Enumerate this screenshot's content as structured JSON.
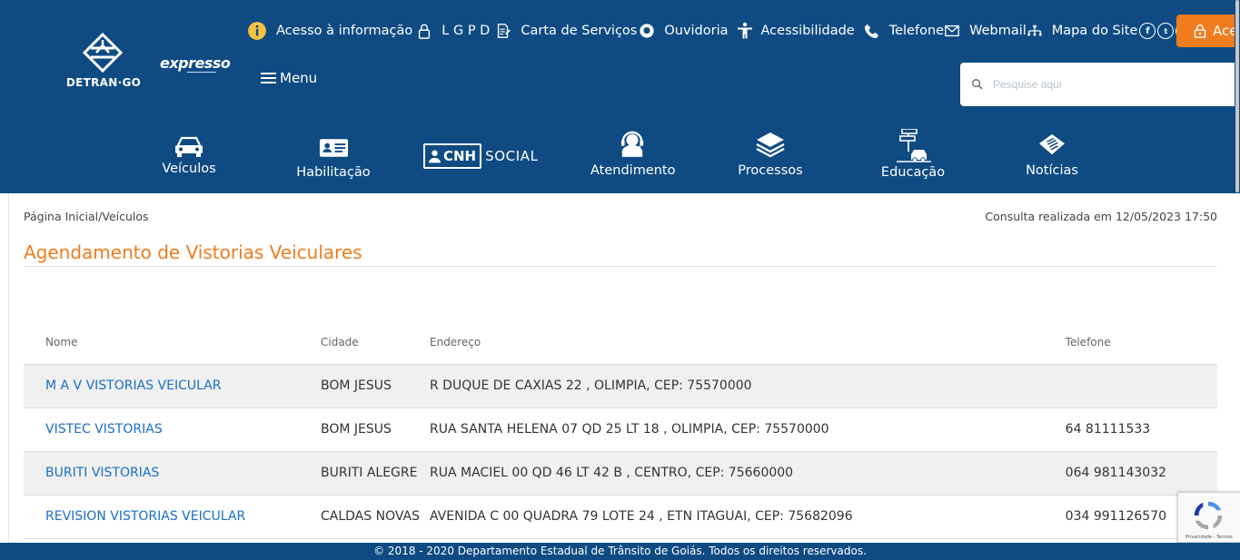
{
  "brand": {
    "detran": "DETRAN·GO",
    "expresso": "expresso"
  },
  "topbar": {
    "links": [
      {
        "label": "Acesso à informação",
        "icon": "info-icon"
      },
      {
        "label": "L G P D",
        "icon": "lock-icon"
      },
      {
        "label": "Carta de Serviços",
        "icon": "document-edit-icon"
      },
      {
        "label": "Ouvidoria",
        "icon": "chat-icon"
      },
      {
        "label": "Acessibilidade",
        "icon": "accessibility-icon"
      },
      {
        "label": "Telefone",
        "icon": "phone-icon"
      },
      {
        "label": "Webmail",
        "icon": "mail-icon"
      },
      {
        "label": "Mapa do Site",
        "icon": "sitemap-icon"
      }
    ],
    "social": [
      "f",
      "t",
      "▶",
      "◎"
    ],
    "acesso_label": "Ace",
    "menu_label": "Menu"
  },
  "search": {
    "placeholder": "Pesquise aqui"
  },
  "categories": [
    {
      "label": "Veículos",
      "icon": "car-icon"
    },
    {
      "label": "Habilitação",
      "icon": "id-card-icon"
    },
    {
      "label": "Atendimento",
      "icon": "headset-icon"
    },
    {
      "label": "Processos",
      "icon": "layers-icon"
    },
    {
      "label": "Educação",
      "icon": "road-sign-car-icon"
    },
    {
      "label": "Notícias",
      "icon": "newspaper-icon"
    }
  ],
  "cnh_social": {
    "cnh": "CNH",
    "social": "SOCIAL"
  },
  "breadcrumb": "Página Inicial/Veículos",
  "consulta": "Consulta realizada em 12/05/2023 17:50",
  "page_title": "Agendamento de Vistorias Veiculares",
  "table": {
    "headers": [
      "Nome",
      "Cidade",
      "Endereço",
      "Telefone"
    ],
    "rows": [
      {
        "nome": "M A V VISTORIAS VEICULAR",
        "cidade": "BOM JESUS",
        "endereco": "R DUQUE DE CAXIAS 22 , OLIMPIA, CEP: 75570000",
        "telefone": ""
      },
      {
        "nome": "VISTEC VISTORIAS",
        "cidade": "BOM JESUS",
        "endereco": "RUA SANTA HELENA 07 QD 25 LT 18 , OLIMPIA, CEP: 75570000",
        "telefone": "64 81111533"
      },
      {
        "nome": "BURITI VISTORIAS",
        "cidade": "BURITI ALEGRE",
        "endereco": "RUA MACIEL 00 QD 46 LT 42 B , CENTRO, CEP: 75660000",
        "telefone": "064 981143032"
      },
      {
        "nome": "REVISION VISTORIAS VEICULAR",
        "cidade": "CALDAS NOVAS",
        "endereco": "AVENIDA C 00 QUADRA 79 LOTE 24 , ETN ITAGUAI, CEP: 75682096",
        "telefone": "034 991126570"
      }
    ]
  },
  "footer": "© 2018 - 2020 Departamento Estadual de Trânsito de Goiás. Todos os direitos reservados.",
  "recaptcha": "Privacidade - Termos",
  "colors": {
    "header": "#0f4b82",
    "accent": "#f07c1e",
    "link": "#1a6fc4"
  }
}
